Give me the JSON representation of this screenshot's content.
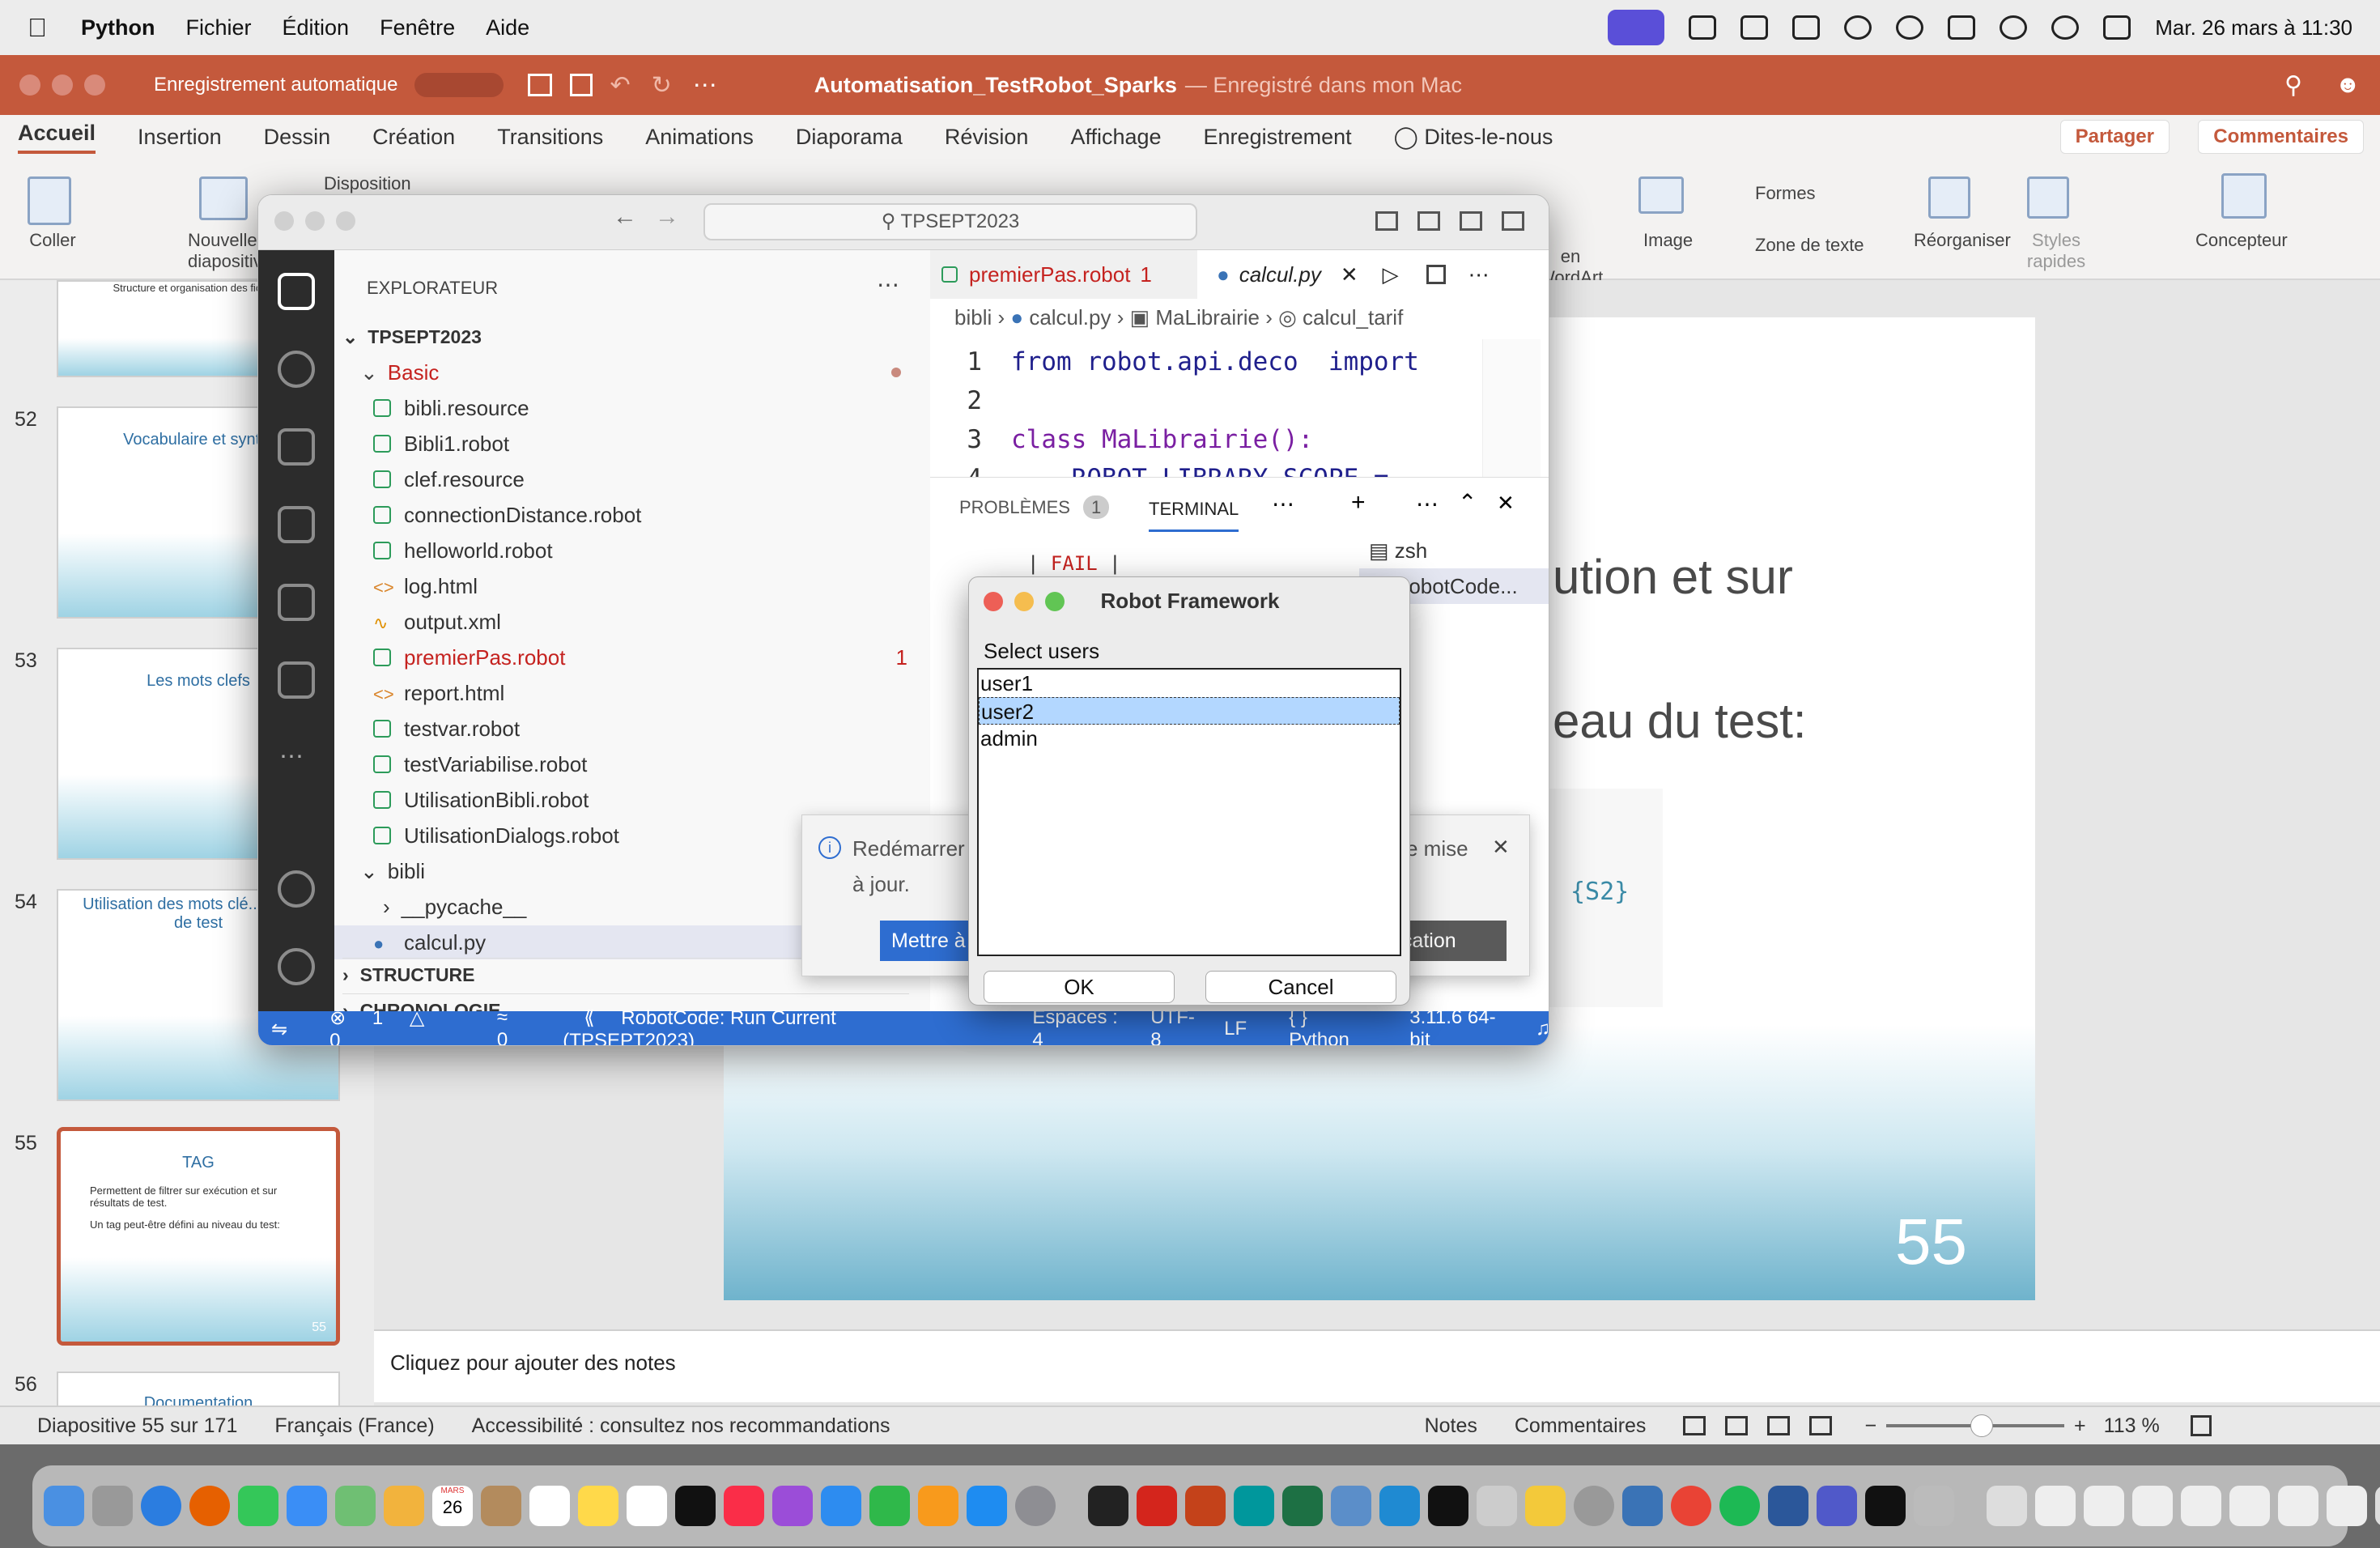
{
  "menubar": {
    "app": "Python",
    "items": [
      "Fichier",
      "Édition",
      "Fenêtre",
      "Aide"
    ],
    "datetime": "Mar. 26 mars à 11:30"
  },
  "powerpoint": {
    "autosave_label": "Enregistrement automatique",
    "title": "Automatisation_TestRobot_Sparks",
    "title_suffix": "— Enregistré dans mon Mac",
    "tabs": [
      "Accueil",
      "Insertion",
      "Dessin",
      "Création",
      "Transitions",
      "Animations",
      "Diaporama",
      "Révision",
      "Affichage",
      "Enregistrement"
    ],
    "tell_me": "Dites-le-nous",
    "share": "Partager",
    "comments": "Commentaires",
    "ribbon": {
      "paste": "Coller",
      "new_slide": "Nouvelle diapositive",
      "layout": "Disposition",
      "image": "Image",
      "shapes": "Formes",
      "textbox": "Zone de texte",
      "arrange": "Réorganiser",
      "quick_styles": "Styles rapides",
      "designer": "Concepteur",
      "artart": "en WordArt"
    },
    "slides": [
      {
        "num": "",
        "title": "Structure et organisation des fichiers"
      },
      {
        "num": "52",
        "title": "Vocabulaire et synt..."
      },
      {
        "num": "53",
        "title": "Les mots clefs"
      },
      {
        "num": "54",
        "title": "Utilisation des mots clé... un cas de test"
      },
      {
        "num": "55",
        "title": "TAG"
      },
      {
        "num": "56",
        "title": "Documentation"
      }
    ],
    "slide55_bullets": [
      "Permettent de filtrer sur exécution et sur résultats de test.",
      "Un tag peut-être défini au niveau du test:"
    ],
    "slide_text1": "ution et sur",
    "slide_text2": "eau du test:",
    "slide_code": "{S2}",
    "slide_number": "55",
    "notes_placeholder": "Cliquez pour ajouter des notes",
    "status": {
      "slide": "Diapositive 55 sur 171",
      "language": "Français (France)",
      "accessibility": "Accessibilité : consultez nos recommandations",
      "notes": "Notes",
      "comments": "Commentaires",
      "zoom": "113 %"
    }
  },
  "vscode": {
    "search": "TPSEPT2023",
    "explorer_title": "EXPLORATEUR",
    "workspace": "TPSEPT2023",
    "folder_basic": "Basic",
    "files": [
      {
        "name": "bibli.resource",
        "kind": "robot"
      },
      {
        "name": "Bibli1.robot",
        "kind": "robot"
      },
      {
        "name": "clef.resource",
        "kind": "robot"
      },
      {
        "name": "connectionDistance.robot",
        "kind": "robot"
      },
      {
        "name": "helloworld.robot",
        "kind": "robot"
      },
      {
        "name": "log.html",
        "kind": "html"
      },
      {
        "name": "output.xml",
        "kind": "rss"
      },
      {
        "name": "premierPas.robot",
        "kind": "robot",
        "badge": "1"
      },
      {
        "name": "report.html",
        "kind": "html"
      },
      {
        "name": "testvar.robot",
        "kind": "robot"
      },
      {
        "name": "testVariabilise.robot",
        "kind": "robot"
      },
      {
        "name": "UtilisationBibli.robot",
        "kind": "robot"
      },
      {
        "name": "UtilisationDialogs.robot",
        "kind": "robot"
      }
    ],
    "folder_bibli": "bibli",
    "pycache": "__pycache__",
    "calcul": "calcul.py",
    "outline": "STRUCTURE",
    "timeline": "CHRONOLOGIE",
    "tabs": [
      {
        "label": "premierPas.robot",
        "badge": "1"
      },
      {
        "label": "calcul.py"
      }
    ],
    "breadcrumb": [
      "bibli",
      "calcul.py",
      "MaLibrairie",
      "calcul_tarif"
    ],
    "code": [
      {
        "ln": "1",
        "text": "from robot.api.deco  import"
      },
      {
        "ln": "2",
        "text": ""
      },
      {
        "ln": "3",
        "text": "class MaLibrairie():"
      },
      {
        "ln": "4",
        "text": "    ROBOT_LIBRARY_SCOPE = "
      }
    ],
    "panel_tabs": [
      "PROBLÈMES",
      "TERMINAL"
    ],
    "problems_count": "1",
    "terminal_fail": "FAIL",
    "terminals": [
      "zsh",
      "RobotCode..."
    ],
    "status": {
      "errors": "1",
      "warnings": "0",
      "ports": "0",
      "run": "RobotCode: Run Current (TPSEPT2023)",
      "spaces": "Espaces : 4",
      "encoding": "UTF-8",
      "eol": "LF",
      "language": "Python",
      "version": "3.11.6 64-bit"
    },
    "notification": {
      "text_a": "Redémarrer",
      "text_b": "e mise",
      "text_c": "à jour.",
      "btn_left": "Mettre à",
      "btn_right": "ublication"
    }
  },
  "dialog": {
    "title": "Robot Framework",
    "label": "Select users",
    "options": [
      "user1",
      "user2",
      "admin"
    ],
    "selected": "user2",
    "ok": "OK",
    "cancel": "Cancel"
  },
  "dock": {
    "calendar_day": "26",
    "calendar_month": "MARS"
  }
}
